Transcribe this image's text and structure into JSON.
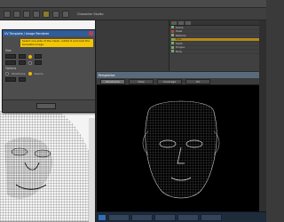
{
  "toolbar": {
    "label": "Character Studio"
  },
  "dialog": {
    "title": "UV Template / Image Renderer",
    "notice": "Select one side of the mesh, unfold it and load the template image.",
    "section_size": "Size",
    "section_options": "Options",
    "option_a": "Wireframe",
    "option_b": "Seams",
    "footer_ok": "Render UV Template"
  },
  "viewport": {
    "title": "Perspective",
    "tabs": [
      "Wireframe",
      "View",
      "Coverage",
      "UV"
    ]
  },
  "outliner": {
    "rows": [
      "Scene",
      "Head",
      "Material",
      "Eyes",
      "Teeth",
      "Tongue",
      "Body"
    ]
  },
  "colors": {
    "accent": "#f2b400",
    "dialog_title": "#2f5d9a",
    "selection": "#b48a16"
  }
}
